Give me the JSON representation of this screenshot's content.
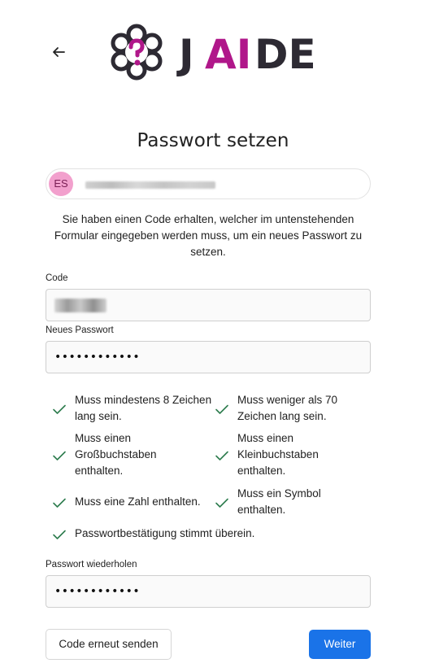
{
  "header": {
    "back_icon": "arrow-left-icon",
    "logo": {
      "text_j": "J",
      "text_ai": "AI",
      "text_de": "DE",
      "brand_color": "#b0178a",
      "dark_color": "#2d2a33"
    }
  },
  "page": {
    "title": "Passwort setzen",
    "account": {
      "initials": "ES",
      "avatar_color": "#f2a0cd"
    },
    "info_text": "Sie haben einen Code erhalten, welcher im untenstehenden Formular eingegeben werden muss, um ein neues Passwort zu setzen."
  },
  "form": {
    "code_label": "Code",
    "new_password_label": "Neues Passwort",
    "new_password_value": "••••••••••••",
    "repeat_password_label": "Passwort wiederholen",
    "repeat_password_value": "••••••••••••"
  },
  "rules": [
    {
      "text": "Muss mindestens 8 Zeichen lang sein.",
      "ok": true
    },
    {
      "text": "Muss weniger als 70 Zeichen lang sein.",
      "ok": true
    },
    {
      "text": "Muss einen Großbuchstaben enthalten.",
      "ok": true
    },
    {
      "text": "Muss einen Kleinbuchstaben enthalten.",
      "ok": true
    },
    {
      "text": "Muss eine Zahl enthalten.",
      "ok": true
    },
    {
      "text": "Muss ein Symbol enthalten.",
      "ok": true
    },
    {
      "text": "Passwortbestätigung stimmt überein.",
      "ok": true
    }
  ],
  "check_color": "#2e7d4f",
  "actions": {
    "resend_label": "Code erneut senden",
    "continue_label": "Weiter",
    "primary_color": "#1a73e8"
  }
}
